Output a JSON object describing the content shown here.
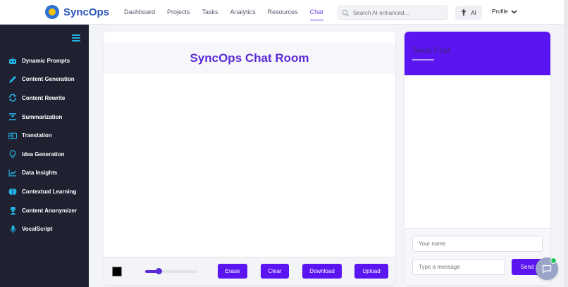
{
  "brand": {
    "name": "SyncOps"
  },
  "nav": {
    "items": [
      {
        "label": "Dashboard"
      },
      {
        "label": "Projects"
      },
      {
        "label": "Tasks"
      },
      {
        "label": "Analytics"
      },
      {
        "label": "Resources"
      },
      {
        "label": "Chat",
        "active": true
      }
    ]
  },
  "search": {
    "placeholder": "Search AI-enhanced..."
  },
  "ai_button": {
    "label": "AI"
  },
  "profile": {
    "label": "Profile"
  },
  "sidebar": {
    "items": [
      {
        "label": "Dynamic Prompts",
        "icon": "robot-icon"
      },
      {
        "label": "Content Generation",
        "icon": "pen-icon"
      },
      {
        "label": "Content Rewrite",
        "icon": "refresh-icon"
      },
      {
        "label": "Summarization",
        "icon": "summary-icon"
      },
      {
        "label": "Translation",
        "icon": "translate-icon"
      },
      {
        "label": "Idea Generation",
        "icon": "lightbulb-icon"
      },
      {
        "label": "Data Insights",
        "icon": "chart-line-icon"
      },
      {
        "label": "Contextual Learning",
        "icon": "brain-icon"
      },
      {
        "label": "Content Anonymizer",
        "icon": "user-secret-icon"
      },
      {
        "label": "VocalScript",
        "icon": "microphone-icon"
      }
    ]
  },
  "board": {
    "title": "SyncOps Chat Room",
    "brush_color": "#000000",
    "brush_size_fraction": 0.25,
    "tools": {
      "erase": "Erase",
      "clear": "Clear",
      "download": "Download",
      "upload": "Upload"
    }
  },
  "chat": {
    "title": "Team Chat",
    "name_placeholder": "Your name",
    "message_placeholder": "Type a message",
    "send_label": "Send"
  },
  "colors": {
    "accent": "#5b15f0",
    "sidebar_bg": "#1f2131",
    "sidebar_icon": "#22b3e6"
  }
}
